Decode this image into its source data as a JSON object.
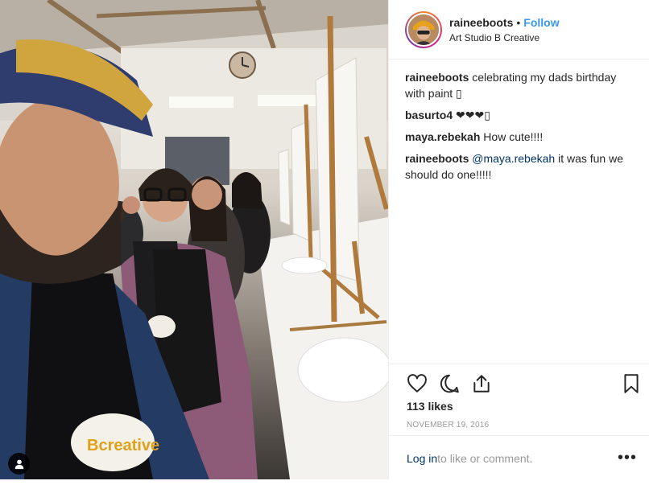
{
  "post": {
    "username": "raineeboots",
    "follow_label": "Follow",
    "separator": "•",
    "location": "Art Studio B Creative"
  },
  "comments": [
    {
      "user": "raineeboots",
      "text": "celebrating my dads birthday with paint ",
      "emoji": "▯"
    },
    {
      "user": "basurto4",
      "text": "❤❤❤",
      "emoji": "▯"
    },
    {
      "user": "maya.rebekah",
      "text": "How cute!!!!"
    },
    {
      "user": "raineeboots",
      "mention": "@maya.rebekah",
      "text": " it was fun we should do one!!!!!"
    }
  ],
  "likes_label": "113 likes",
  "date": "NOVEMBER 19, 2016",
  "login": {
    "link": "Log in",
    "rest": " to like or comment."
  },
  "more_label": "•••",
  "photo": {
    "apron_text": "Bcreative"
  },
  "icons": [
    "heart-icon",
    "comment-icon",
    "share-icon",
    "bookmark-icon",
    "user-tag-icon",
    "more-icon"
  ],
  "colors": {
    "follow": "#3897f0",
    "mention": "#003569",
    "meta": "#999999"
  }
}
